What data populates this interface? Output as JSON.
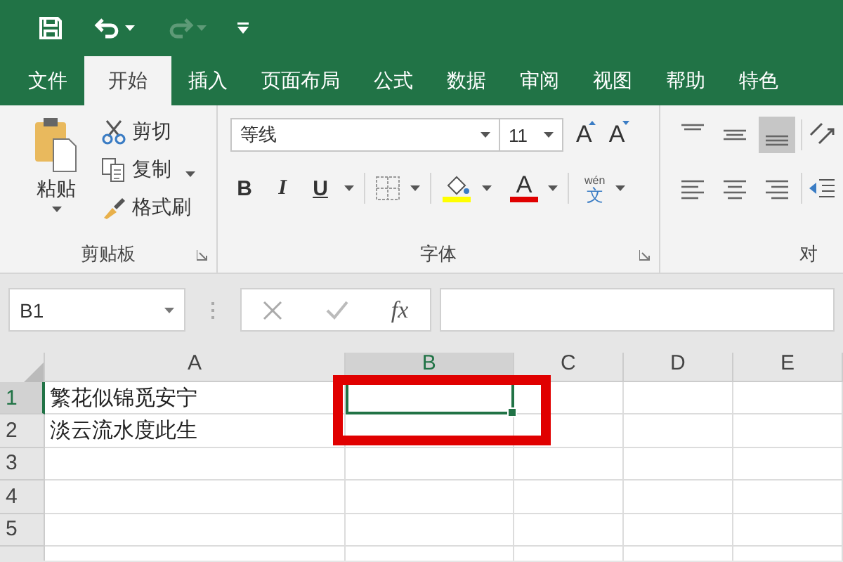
{
  "quick_access": [
    {
      "kind": "save",
      "disabled": false
    },
    {
      "kind": "undo",
      "disabled": false
    },
    {
      "kind": "redo",
      "disabled": true
    },
    {
      "kind": "customize",
      "disabled": false
    }
  ],
  "tabs": [
    {
      "label": "文件",
      "selected": false
    },
    {
      "label": "开始",
      "selected": true
    },
    {
      "label": "插入",
      "selected": false
    },
    {
      "label": "页面布局",
      "selected": false
    },
    {
      "label": "公式",
      "selected": false
    },
    {
      "label": "数据",
      "selected": false
    },
    {
      "label": "审阅",
      "selected": false
    },
    {
      "label": "视图",
      "selected": false
    },
    {
      "label": "帮助",
      "selected": false
    },
    {
      "label": "特色",
      "selected": false
    }
  ],
  "clipboard": {
    "paste": "粘贴",
    "items": [
      {
        "kind": "cut",
        "label": "剪切",
        "dropdown": false
      },
      {
        "kind": "copy",
        "label": "复制",
        "dropdown": true
      },
      {
        "kind": "painter",
        "label": "格式刷",
        "dropdown": false
      }
    ],
    "group_label": "剪贴板"
  },
  "font": {
    "name": "等线",
    "size": "11",
    "size_buttons": [
      {
        "kind": "grow",
        "glyph": "A"
      },
      {
        "kind": "shrink",
        "glyph": "A"
      }
    ],
    "bold": "B",
    "italic": "I",
    "underline": "U",
    "fill_color": {
      "color": "#ffff00"
    },
    "font_color": {
      "glyph": "A",
      "color": "#e00000"
    },
    "phonetic": {
      "top": "wén",
      "glyph": "文"
    },
    "group_label": "字体"
  },
  "alignment": {
    "vertical": [
      {
        "kind": "top",
        "selected": false
      },
      {
        "kind": "middle",
        "selected": false
      },
      {
        "kind": "bottom",
        "selected": true
      }
    ],
    "horizontal": [
      {
        "kind": "left",
        "selected": false
      },
      {
        "kind": "center",
        "selected": false
      },
      {
        "kind": "right",
        "selected": false
      }
    ],
    "group_label": "对"
  },
  "formula_bar": {
    "name_box": "B1",
    "function_button": "fx"
  },
  "columns": [
    {
      "label": "A",
      "selected": false
    },
    {
      "label": "B",
      "selected": true
    },
    {
      "label": "C",
      "selected": false
    },
    {
      "label": "D",
      "selected": false
    },
    {
      "label": "E",
      "selected": false
    }
  ],
  "rows": [
    {
      "header": "1",
      "selected": true,
      "cells": [
        "繁花似锦觅安宁"
      ]
    },
    {
      "header": "2",
      "selected": false,
      "cells": [
        "淡云流水度此生"
      ]
    },
    {
      "header": "3",
      "selected": false,
      "cells": []
    },
    {
      "header": "4",
      "selected": false,
      "cells": []
    },
    {
      "header": "5",
      "selected": false,
      "cells": []
    }
  ],
  "annotation": {
    "kind": "highlight-box"
  }
}
